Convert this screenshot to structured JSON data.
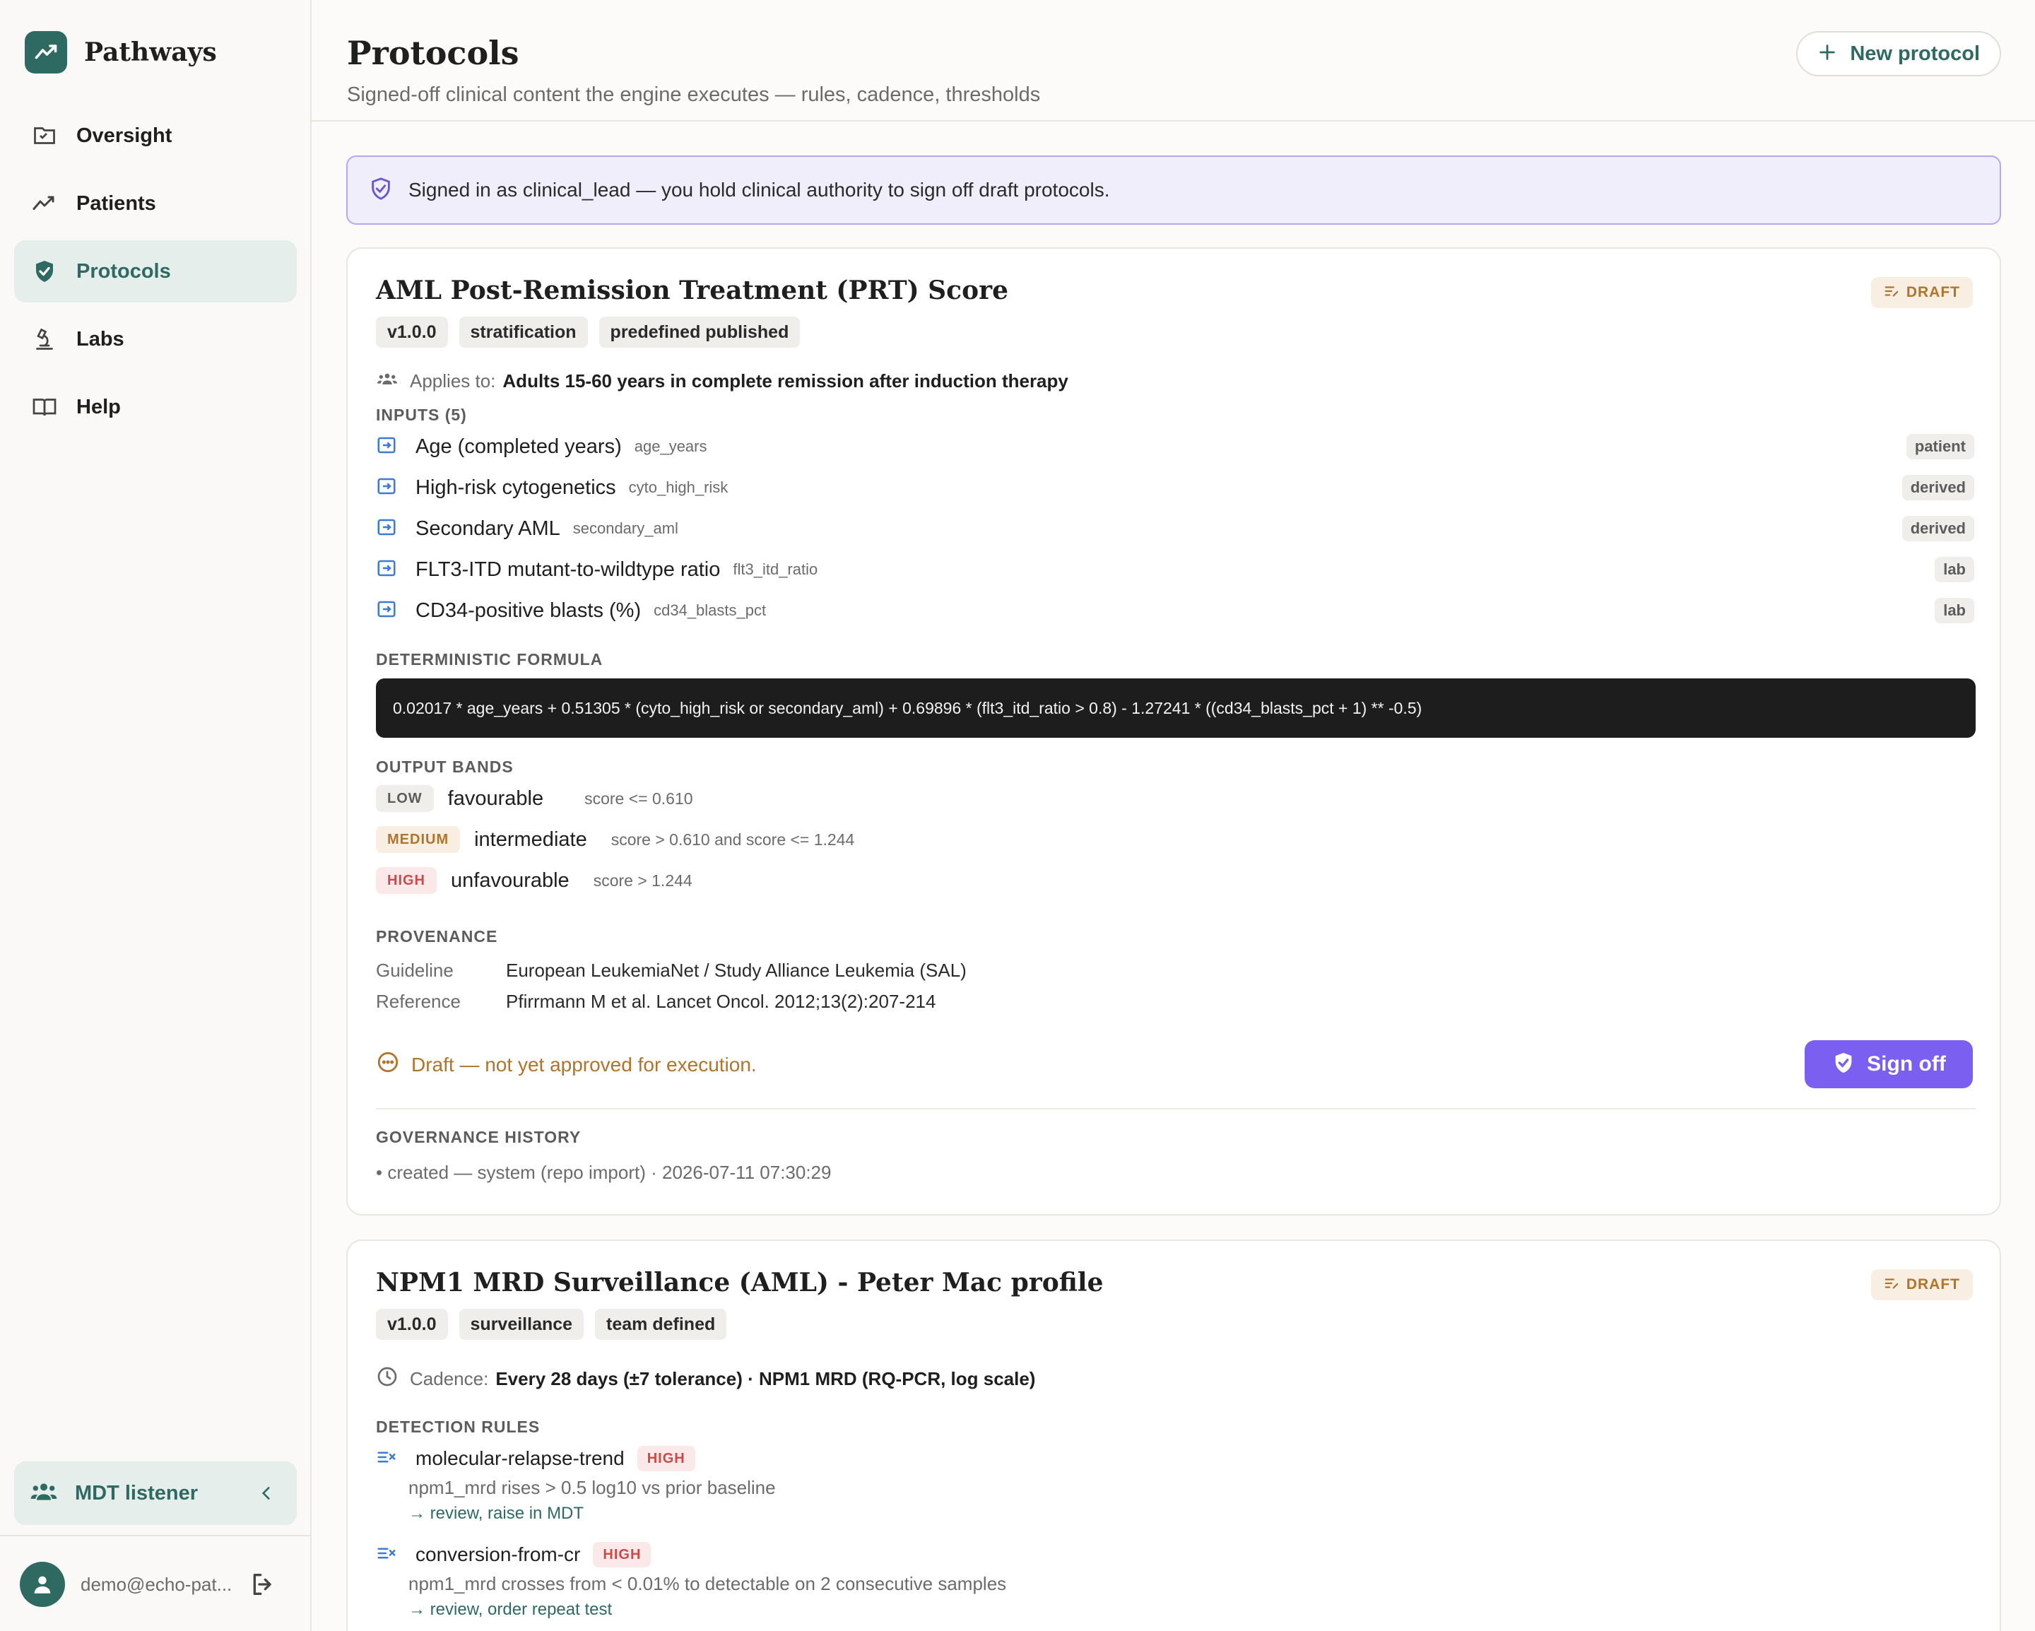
{
  "brand": {
    "name": "Pathways"
  },
  "sidebar": {
    "items": [
      {
        "label": "Oversight",
        "icon": "oversight-icon"
      },
      {
        "label": "Patients",
        "icon": "trend-icon"
      },
      {
        "label": "Protocols",
        "icon": "shield-check-icon",
        "active": true
      },
      {
        "label": "Labs",
        "icon": "microscope-icon"
      },
      {
        "label": "Help",
        "icon": "book-icon"
      }
    ],
    "mdt_label": "MDT listener",
    "user_email": "demo@echo-pat..."
  },
  "header": {
    "title": "Protocols",
    "subtitle": "Signed-off clinical content the engine executes — rules, cadence, thresholds",
    "new_button": "New protocol"
  },
  "banner": {
    "text": "Signed in as clinical_lead — you hold clinical authority to sign off draft protocols."
  },
  "colors": {
    "accent": "#2f6a62",
    "signoff": "#7b5ff0",
    "draft": "#b0742a",
    "high": "#cc4a4a"
  },
  "card1": {
    "title": "AML Post-Remission Treatment (PRT) Score",
    "status": "DRAFT",
    "chips": [
      "v1.0.0",
      "stratification",
      "predefined published"
    ],
    "applies_prefix": "Applies to:",
    "applies_value": "Adults 15-60 years in complete remission after induction therapy",
    "inputs_label": "INPUTS (5)",
    "inputs": [
      {
        "name": "Age (completed years)",
        "key": "age_years",
        "source": "patient"
      },
      {
        "name": "High-risk cytogenetics",
        "key": "cyto_high_risk",
        "source": "derived"
      },
      {
        "name": "Secondary AML",
        "key": "secondary_aml",
        "source": "derived"
      },
      {
        "name": "FLT3-ITD mutant-to-wildtype ratio",
        "key": "flt3_itd_ratio",
        "source": "lab"
      },
      {
        "name": "CD34-positive blasts (%)",
        "key": "cd34_blasts_pct",
        "source": "lab"
      }
    ],
    "formula_label": "DETERMINISTIC FORMULA",
    "formula": "0.02017 * age_years + 0.51305 * (cyto_high_risk or secondary_aml) + 0.69896 * (flt3_itd_ratio > 0.8) - 1.27241 * ((cd34_blasts_pct + 1) ** -0.5)",
    "bands_label": "OUTPUT BANDS",
    "bands": [
      {
        "tag": "LOW",
        "name": "favourable",
        "condition": "score <= 0.610"
      },
      {
        "tag": "MEDIUM",
        "name": "intermediate",
        "condition": "score > 0.610 and score <= 1.244"
      },
      {
        "tag": "HIGH",
        "name": "unfavourable",
        "condition": "score > 1.244"
      }
    ],
    "provenance_label": "PROVENANCE",
    "provenance": [
      {
        "key": "Guideline",
        "value": "European LeukemiaNet / Study Alliance Leukemia (SAL)"
      },
      {
        "key": "Reference",
        "value": "Pfirrmann M et al. Lancet Oncol. 2012;13(2):207-214"
      }
    ],
    "draft_note": "Draft — not yet approved for execution.",
    "signoff_label": "Sign off",
    "history_label": "GOVERNANCE HISTORY",
    "history": [
      "• created — system (repo import) · 2026-07-11 07:30:29"
    ]
  },
  "card2": {
    "title": "NPM1 MRD Surveillance (AML) - Peter Mac profile",
    "status": "DRAFT",
    "chips": [
      "v1.0.0",
      "surveillance",
      "team defined"
    ],
    "cadence_prefix": "Cadence:",
    "cadence_value": "Every 28 days (±7 tolerance) · NPM1 MRD (RQ-PCR, log scale)",
    "rules_label": "DETECTION RULES",
    "rules": [
      {
        "name": "molecular-relapse-trend",
        "severity": "HIGH",
        "description": "npm1_mrd rises > 0.5 log10 vs prior baseline",
        "action": "→ review, raise in MDT"
      },
      {
        "name": "conversion-from-cr",
        "severity": "HIGH",
        "description": "npm1_mrd crosses from < 0.01% to detectable on 2 consecutive samples",
        "action": "→ review, order repeat test"
      }
    ]
  }
}
